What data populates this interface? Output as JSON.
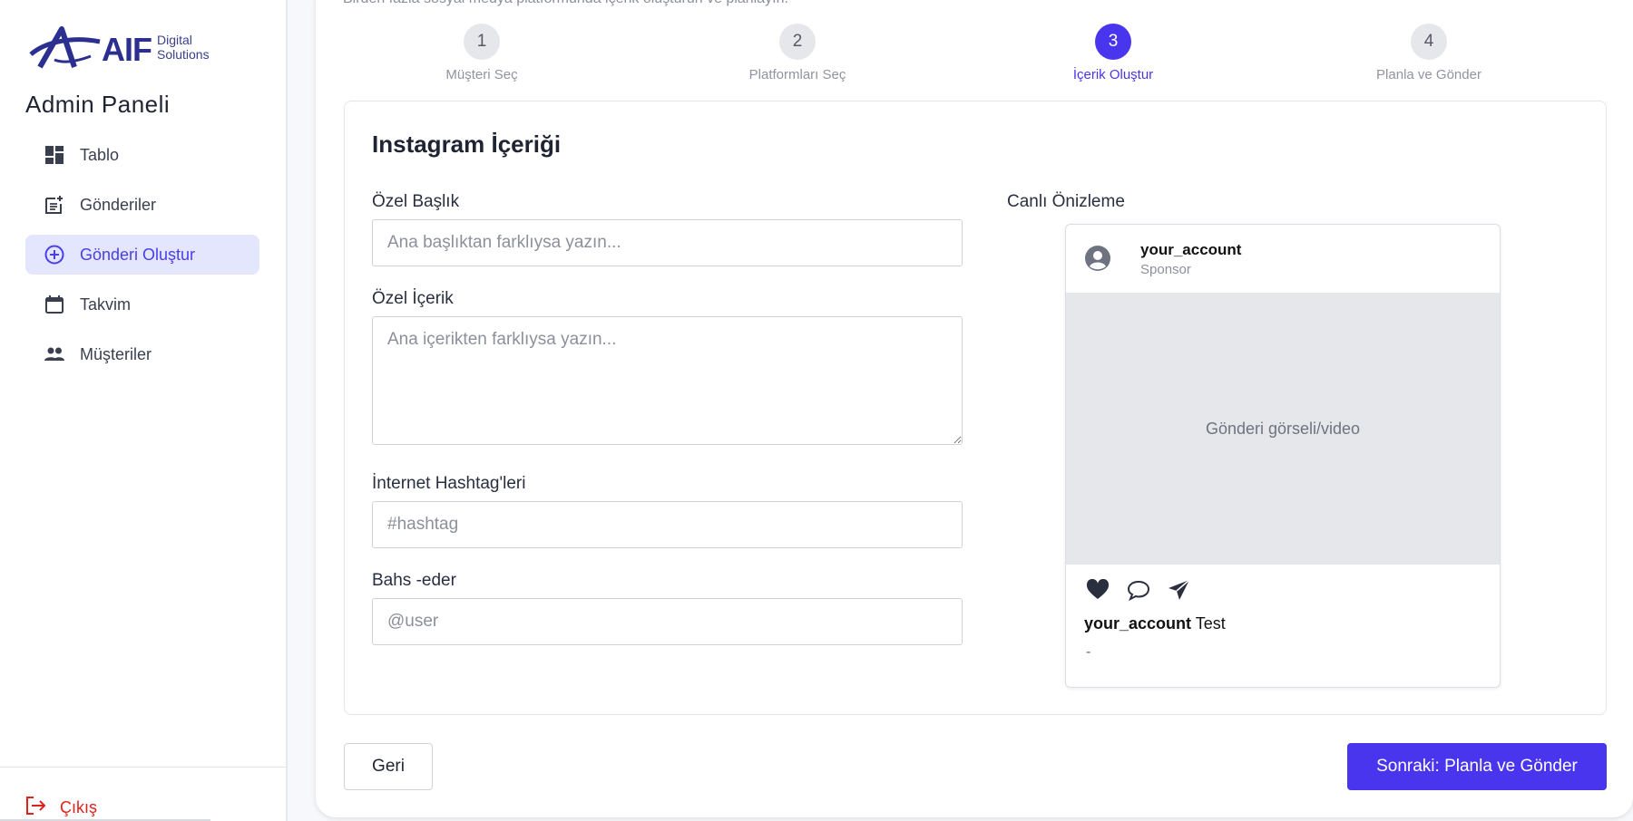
{
  "brand": {
    "name": "AIF",
    "subtitle_line1": "Digital",
    "subtitle_line2": "Solutions"
  },
  "sidebar": {
    "title": "Admin Paneli",
    "items": [
      {
        "label": "Tablo",
        "icon": "dashboard-icon",
        "active": false
      },
      {
        "label": "Gönderiler",
        "icon": "post-add-icon",
        "active": false
      },
      {
        "label": "Gönderi Oluştur",
        "icon": "plus-circle-icon",
        "active": true
      },
      {
        "label": "Takvim",
        "icon": "calendar-icon",
        "active": false
      },
      {
        "label": "Müşteriler",
        "icon": "people-icon",
        "active": false
      }
    ],
    "logout_label": "Çıkış"
  },
  "header": {
    "intro_text": "Birden fazla sosyal medya platformunda içerik oluşturun ve planlayın."
  },
  "steps": [
    {
      "number": "1",
      "label": "Müşteri Seç"
    },
    {
      "number": "2",
      "label": "Platformları Seç"
    },
    {
      "number": "3",
      "label": "İçerik Oluştur"
    },
    {
      "number": "4",
      "label": "Planla ve Gönder"
    }
  ],
  "current_step": 3,
  "form": {
    "title": "Instagram İçeriği",
    "custom_title": {
      "label": "Özel Başlık",
      "placeholder": "Ana başlıktan farklıysa yazın...",
      "value": ""
    },
    "custom_content": {
      "label": "Özel İçerik",
      "placeholder": "Ana içerikten farklıysa yazın...",
      "value": ""
    },
    "hashtags": {
      "label": "İnternet Hashtag'leri",
      "placeholder": "#hashtag",
      "value": ""
    },
    "mentions": {
      "label": "Bahs -eder",
      "placeholder": "@user",
      "value": ""
    }
  },
  "preview": {
    "title": "Canlı Önizleme",
    "username": "your_account",
    "sponsor_label": "Sponsor",
    "media_placeholder": "Gönderi görseli/video",
    "caption_user": "your_account",
    "caption_text": "Test",
    "extra_text": "-"
  },
  "actions": {
    "back_label": "Geri",
    "next_label": "Sonraki: Planla ve Gönder"
  },
  "colors": {
    "accent": "#4a35ee",
    "logout": "#e0201b",
    "active_bg": "#e4e6fd"
  }
}
